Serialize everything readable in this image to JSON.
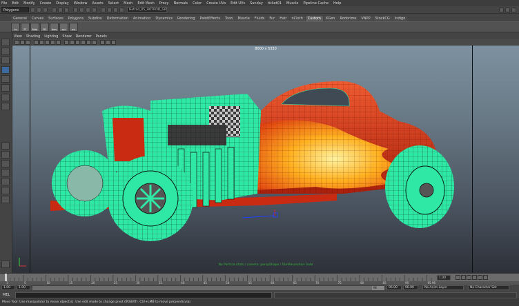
{
  "menubar": [
    "File",
    "Edit",
    "Modify",
    "Create",
    "Display",
    "Window",
    "Assets",
    "Select",
    "Mesh",
    "Edit Mesh",
    "Proxy",
    "Normals",
    "Color",
    "Create UVs",
    "Edit UVs",
    "Sunday",
    "ticket01",
    "Muscle",
    "Pipeline Cache",
    "Help"
  ],
  "status": {
    "mode": "Polygons",
    "scene_field": "Hotrod_05_HOTROD_GRP"
  },
  "shelf_tabs": [
    "General",
    "Curves",
    "Surfaces",
    "Polygons",
    "Subdivs",
    "Deformation",
    "Animation",
    "Dynamics",
    "Rendering",
    "PaintEffects",
    "Toon",
    "Muscle",
    "Fluids",
    "Fur",
    "Hair",
    "nCloth",
    "Custom",
    "XGen",
    "Rodorime",
    "VNPP",
    "StockCG",
    "Indigo"
  ],
  "shelf_active": "Custom",
  "shelf_buttons": [
    "cv",
    "FT",
    "Mod",
    "FR",
    "lens",
    "scr",
    "ex"
  ],
  "panel_menu": [
    "View",
    "Shading",
    "Lighting",
    "Show",
    "Renderer",
    "Panels"
  ],
  "viewport": {
    "resolution": "8000 x 5330",
    "overlay_text": "No Particle stats / camera: perspShape / FilmResolution Gate"
  },
  "time": {
    "ticks": [
      "1",
      "5",
      "10",
      "15",
      "20",
      "25",
      "30",
      "35",
      "40",
      "45",
      "50",
      "55",
      "60",
      "65",
      "70",
      "75",
      "80",
      "85",
      "90",
      "95",
      "96"
    ],
    "current_frame": "1.00"
  },
  "range": {
    "start": "1.00",
    "start2": "1.00",
    "end": "96",
    "end2": "96.00",
    "end3": "96.00",
    "anim_layer": "No Anim Layer",
    "char_set": "No Character Set"
  },
  "cmd": {
    "label": "MEL"
  },
  "help_text": "Move Tool: Use manipulator to move object(s). Use edit mode to change pivot (INSERT). Ctrl+LMB to move perpendicular.",
  "colors": {
    "wire": "#2fe8a5",
    "body_red": "#d8321a",
    "flame_yellow": "#ffd23a"
  }
}
